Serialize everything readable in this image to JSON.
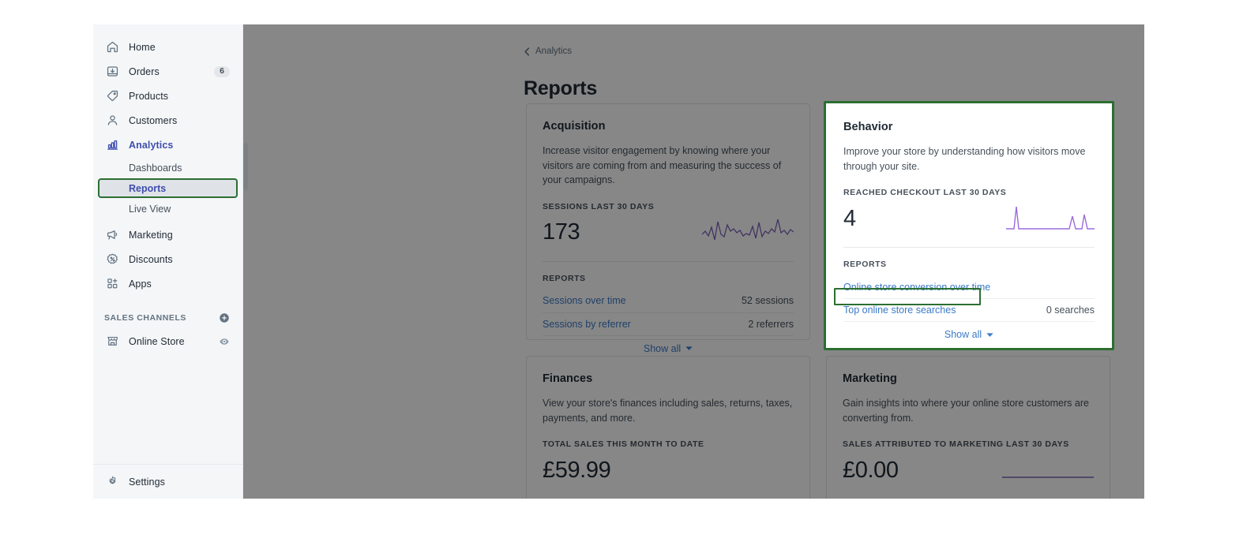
{
  "sidebar": {
    "nav_items": [
      {
        "label": "Home",
        "icon": "home-icon",
        "badge": ""
      },
      {
        "label": "Orders",
        "icon": "orders-icon",
        "badge": "6"
      },
      {
        "label": "Products",
        "icon": "products-tag-icon",
        "badge": ""
      },
      {
        "label": "Customers",
        "icon": "customers-icon",
        "badge": ""
      },
      {
        "label": "Analytics",
        "icon": "analytics-bars-icon",
        "badge": ""
      }
    ],
    "analytics_sub_items": [
      {
        "label": "Dashboards"
      },
      {
        "label": "Reports"
      },
      {
        "label": "Live View"
      }
    ],
    "nav_items_lower": [
      {
        "label": "Marketing",
        "icon": "megaphone-icon"
      },
      {
        "label": "Discounts",
        "icon": "discount-badge-icon"
      },
      {
        "label": "Apps",
        "icon": "apps-grid-icon"
      }
    ],
    "sales_channels": {
      "title": "SALES CHANNELS",
      "add_icon": "plus-circle-icon",
      "items": [
        {
          "label": "Online Store",
          "icon": "storefront-icon",
          "action_icon": "eye-icon"
        }
      ]
    },
    "settings": {
      "label": "Settings",
      "icon": "gear-icon"
    }
  },
  "main": {
    "breadcrumb": {
      "label": "Analytics",
      "icon": "chevron-left-icon"
    },
    "page_title": "Reports",
    "cards": [
      {
        "id": "acquisition",
        "title": "Acquisition",
        "description": "Increase visitor engagement by knowing where your visitors are coming from and measuring the success of your campaigns.",
        "metric_label": "SESSIONS LAST 30 DAYS",
        "metric_value": "173",
        "reports_label": "REPORTS",
        "reports": [
          {
            "link": "Sessions over time",
            "count": "52 sessions"
          },
          {
            "link": "Sessions by referrer",
            "count": "2 referrers"
          }
        ],
        "show_all": "Show all"
      },
      {
        "id": "behavior",
        "title": "Behavior",
        "description": "Improve your store by understanding how visitors move through your site.",
        "metric_label": "REACHED CHECKOUT LAST 30 DAYS",
        "metric_value": "4",
        "reports_label": "REPORTS",
        "reports": [
          {
            "link": "Online store conversion over time",
            "count": ""
          },
          {
            "link": "Top online store searches",
            "count": "0 searches"
          }
        ],
        "show_all": "Show all"
      },
      {
        "id": "finances",
        "title": "Finances",
        "description": "View your store's finances including sales, returns, taxes, payments, and more.",
        "metric_label": "TOTAL SALES THIS MONTH TO DATE",
        "metric_value": "£59.99"
      },
      {
        "id": "marketing",
        "title": "Marketing",
        "description": "Gain insights into where your online store customers are converting from.",
        "metric_label": "SALES ATTRIBUTED TO MARKETING LAST 30 DAYS",
        "metric_value": "£0.00"
      }
    ]
  },
  "colors": {
    "highlight_green": "#2c6e31",
    "link_blue": "#3b7ac7",
    "accent_indigo": "#3f4eae",
    "spark_purple": "#9c6ade",
    "sidebar_bg": "#f4f6f8",
    "active_bg": "#dfe3e8"
  },
  "chart_data": [
    {
      "type": "line",
      "title": "Sessions last 30 days sparkline",
      "xlabel": "",
      "ylabel": "Sessions",
      "values": [
        4,
        3,
        7,
        2,
        9,
        1,
        4,
        3,
        8,
        5,
        6,
        4,
        5,
        3,
        4,
        3,
        7,
        2,
        8,
        3,
        5,
        4,
        6,
        5,
        10,
        4,
        5,
        4,
        6,
        5
      ],
      "ylim": [
        0,
        11
      ],
      "grid": false,
      "legend": "none"
    },
    {
      "type": "line",
      "title": "Reached checkout last 30 days sparkline",
      "xlabel": "",
      "ylabel": "Reached checkout",
      "values": [
        0,
        0,
        0,
        3,
        0,
        0,
        0,
        0,
        0,
        0,
        0,
        0,
        0,
        0,
        0,
        0,
        0,
        0,
        0,
        0,
        0,
        0,
        1.6,
        0,
        1.6,
        0,
        0,
        0,
        0,
        0
      ],
      "ylim": [
        0,
        3.4
      ],
      "grid": false,
      "legend": "none"
    },
    {
      "type": "line",
      "title": "Sales attributed to marketing last 30 days sparkline",
      "xlabel": "",
      "ylabel": "Sales",
      "values": [
        0,
        0,
        0,
        0,
        0,
        0,
        0,
        0,
        0,
        0,
        0,
        0,
        0,
        0,
        0,
        0,
        0,
        0,
        0,
        0,
        0,
        0,
        0,
        0,
        0,
        0,
        0,
        0,
        0,
        0
      ],
      "ylim": [
        0,
        1
      ],
      "grid": false,
      "legend": "none"
    }
  ]
}
